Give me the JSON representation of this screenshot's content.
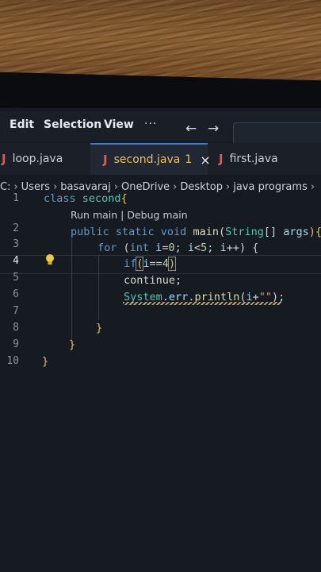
{
  "menu": {
    "edit": "Edit",
    "selection": "Selection",
    "view": "View",
    "more": "···"
  },
  "tabs": [
    {
      "label": "loop.java",
      "icon": "J"
    },
    {
      "label": "second.java",
      "icon": "J",
      "modified": "1",
      "close": "×"
    },
    {
      "label": "first.java",
      "icon": "J"
    }
  ],
  "breadcrumb": [
    "C:",
    "Users",
    "basavaraj",
    "OneDrive",
    "Desktop",
    "java programs"
  ],
  "codelens": "Run main | Debug main",
  "line_numbers": [
    "1",
    "2",
    "3",
    "4",
    "5",
    "6",
    "7",
    "8",
    "9",
    "10"
  ],
  "code": {
    "l1": {
      "kw": "class ",
      "name": "second",
      "brace": "{"
    },
    "l2": {
      "mods": "public static void ",
      "fn": "main",
      "open": "(",
      "type": "String",
      "arr": "[] ",
      "param": "args",
      "close": "){"
    },
    "l3": {
      "kw": "for ",
      "p1": "(",
      "type": "int ",
      "v1": "i",
      "eq": "=",
      "n0": "0",
      "s1": "; ",
      "v2": "i",
      "lt": "<",
      "n5": "5",
      "s2": "; ",
      "v3": "i",
      "inc": "++",
      "p2": ") {"
    },
    "l4": {
      "kw": "if",
      "open": "(",
      "v": "i",
      "op": "==",
      "n": "4",
      "close": ")"
    },
    "l5": {
      "kw": "continue;"
    },
    "l6": {
      "cls": "System",
      "d1": ".",
      "fld": "err",
      "d2": ".",
      "fn": "println",
      "open": "(",
      "v": "i",
      "plus": "+",
      "str": "\"\"",
      "close": ");"
    },
    "l8": "}",
    "l9": "}",
    "l10": "}"
  }
}
